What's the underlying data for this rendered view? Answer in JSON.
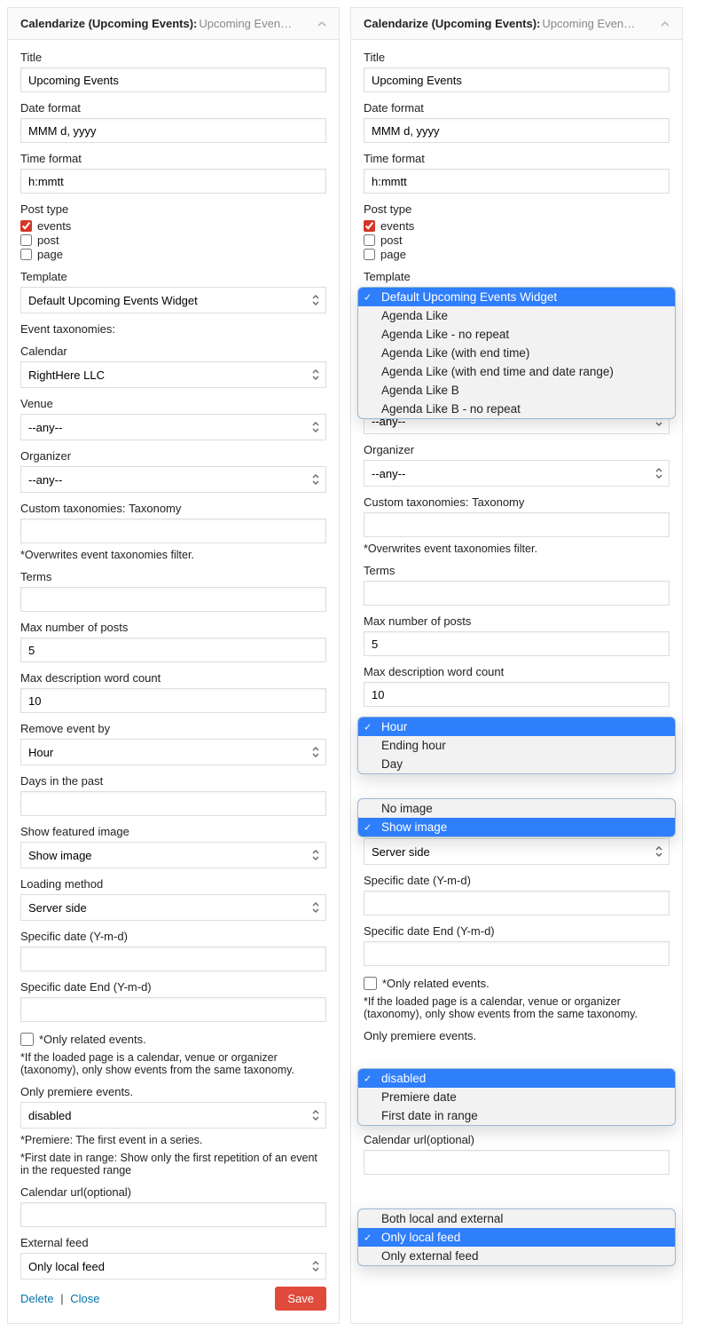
{
  "header": {
    "title_prefix": "Calendarize (Upcoming Events):",
    "title_value": "Upcoming Even…"
  },
  "labels": {
    "title": "Title",
    "date_format": "Date format",
    "time_format": "Time format",
    "post_type": "Post type",
    "template": "Template",
    "event_tax": "Event taxonomies:",
    "calendar": "Calendar",
    "venue": "Venue",
    "organizer": "Organizer",
    "custom_tax": "Custom taxonomies:",
    "taxonomy_word": "Taxonomy",
    "overwrite_note": "*Overwrites event taxonomies filter.",
    "terms": "Terms",
    "max_posts": "Max number of posts",
    "max_desc": "Max description word count",
    "remove_event_by": "Remove event by",
    "days_past": "Days in the past",
    "show_featured": "Show featured image",
    "loading_method": "Loading method",
    "specific_date": "Specific date (Y-m-d)",
    "specific_date_end": "Specific date End (Y-m-d)",
    "only_related": "*Only related events.",
    "only_related_note": "*If the loaded page is a calendar, venue or organizer (taxonomy), only show events from the same taxonomy.",
    "only_premiere": "Only premiere events.",
    "premiere_note": "*Premiere: The first event in a series.",
    "first_range_note": "*First date in range: Show only the first repetition of an event in the requested range",
    "calendar_url": "Calendar url(optional)",
    "external_feed": "External feed",
    "delete": "Delete",
    "close": "Close",
    "save": "Save"
  },
  "values": {
    "title": "Upcoming Events",
    "date_format": "MMM d, yyyy",
    "time_format": "h:mmtt",
    "template": "Default Upcoming Events Widget",
    "calendar": "RightHere LLC",
    "venue": "--any--",
    "organizer": "--any--",
    "max_posts": "5",
    "max_desc": "10",
    "remove_event_by": "Hour",
    "show_featured": "Show image",
    "loading_method": "Server side",
    "only_premiere": "disabled",
    "external_feed": "Only local feed"
  },
  "post_types": [
    {
      "label": "events",
      "checked": true
    },
    {
      "label": "post",
      "checked": false
    },
    {
      "label": "page",
      "checked": false
    }
  ],
  "dropdowns": {
    "template": {
      "selected": "Default Upcoming Events Widget",
      "options": [
        "Default Upcoming Events Widget",
        "Agenda Like",
        "Agenda Like - no repeat",
        "Agenda Like (with end time)",
        "Agenda Like (with end time and date range)",
        "Agenda Like B",
        "Agenda Like B - no repeat"
      ]
    },
    "remove_event_by": {
      "selected": "Hour",
      "options": [
        "Hour",
        "Ending hour",
        "Day"
      ]
    },
    "show_featured": {
      "selected": "Show image",
      "options": [
        "No image",
        "Show image"
      ]
    },
    "only_premiere": {
      "selected": "disabled",
      "options": [
        "disabled",
        "Premiere date",
        "First date in range"
      ]
    },
    "external_feed": {
      "selected": "Only local feed",
      "options": [
        "Both local and external",
        "Only local feed",
        "Only external feed"
      ]
    }
  }
}
